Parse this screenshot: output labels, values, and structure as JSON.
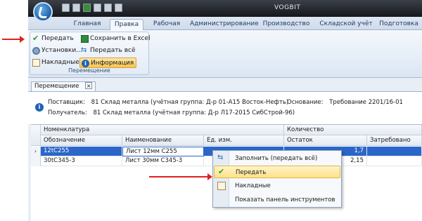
{
  "app_title": "VOGBIT",
  "tabs": [
    {
      "label": "Главная",
      "active": false
    },
    {
      "label": "Правка",
      "active": true
    },
    {
      "label": "Рабочая",
      "active": false
    },
    {
      "label": "Администрирование",
      "active": false
    },
    {
      "label": "Производство",
      "active": false
    },
    {
      "label": "Складской учёт",
      "active": false
    },
    {
      "label": "Подготовка",
      "active": false
    }
  ],
  "ribbon": {
    "group_label": "Перемещение",
    "buttons": {
      "transfer": "Передать",
      "install": "Установки...",
      "invoices": "Накладные",
      "save_excel": "Сохранить в Excel",
      "transfer_all": "Передать всё",
      "information": "Информация"
    }
  },
  "doc_tab": {
    "label": "Перемещение",
    "close": "×"
  },
  "info": {
    "supplier_label": "Поставщик:",
    "supplier_value": "81 Склад металла (учётная группа: Д-р 01-А15 Восток-Нефть)",
    "receiver_label": "Получатель:",
    "receiver_value": "81 Склад металла (учётная группа: Д-р Л17-2015 СибСтрой-96)",
    "basis_label": "Основание:",
    "basis_value": "Требование 2201/16-01"
  },
  "grid": {
    "group_headers": {
      "nomenclature": "Номенклатура",
      "quantity": "Количество"
    },
    "columns": {
      "designation": "Обозначение",
      "name": "Наименование",
      "unit": "Ед. изм.",
      "remainder": "Остаток",
      "requested": "Затребовано"
    },
    "rows": [
      {
        "indicator": "›",
        "designation": "12tC255",
        "name": "Лист 12мм С255",
        "unit": "",
        "remainder": "1,7",
        "requested": ""
      },
      {
        "indicator": "",
        "designation": "30tC345-3",
        "name": "Лист 30мм С345-3",
        "unit": "",
        "remainder": "2,15",
        "requested": ""
      }
    ]
  },
  "context_menu": {
    "items": [
      {
        "label": "Заполнить (передать всё)",
        "icon": "fill-arrows-icon",
        "highlighted": false
      },
      {
        "label": "Передать",
        "icon": "checkmark-icon",
        "highlighted": true
      },
      {
        "label": "Накладные",
        "icon": "document-icon",
        "highlighted": false
      },
      {
        "label": "Показать панель инструментов",
        "icon": "",
        "highlighted": false
      }
    ]
  },
  "colors": {
    "accent": "#2b66c8",
    "highlight": "#fde28a",
    "annotation_arrow": "#e02020"
  }
}
